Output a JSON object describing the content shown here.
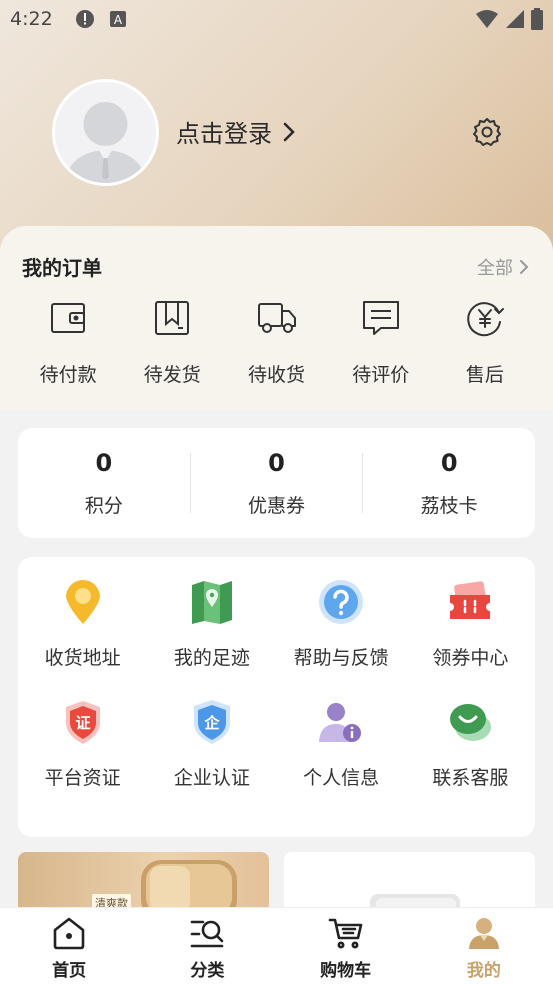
{
  "status_bar": {
    "time": "4:22",
    "icons": [
      "alert-icon",
      "keyboard-a-icon"
    ],
    "right_icons": [
      "wifi-icon",
      "signal-icon",
      "battery-icon"
    ]
  },
  "profile": {
    "login_label": "点击登录",
    "avatar_icon": "user-avatar-icon",
    "settings_icon": "gear-icon"
  },
  "orders": {
    "title": "我的订单",
    "all_label": "全部",
    "items": [
      {
        "label": "待付款",
        "icon": "wallet-icon"
      },
      {
        "label": "待发货",
        "icon": "package-icon"
      },
      {
        "label": "待收货",
        "icon": "truck-icon"
      },
      {
        "label": "待评价",
        "icon": "comment-icon"
      },
      {
        "label": "售后",
        "icon": "refund-icon"
      }
    ]
  },
  "stats": [
    {
      "value": "0",
      "label": "积分"
    },
    {
      "value": "0",
      "label": "优惠券"
    },
    {
      "value": "0",
      "label": "荔枝卡"
    }
  ],
  "services": [
    {
      "label": "收货地址",
      "icon": "location-pin-icon"
    },
    {
      "label": "我的足迹",
      "icon": "map-icon"
    },
    {
      "label": "帮助与反馈",
      "icon": "help-icon"
    },
    {
      "label": "领券中心",
      "icon": "coupon-icon"
    },
    {
      "label": "平台资证",
      "icon": "certificate-icon"
    },
    {
      "label": "企业认证",
      "icon": "enterprise-shield-icon"
    },
    {
      "label": "个人信息",
      "icon": "person-info-icon"
    },
    {
      "label": "联系客服",
      "icon": "customer-service-icon"
    }
  ],
  "products": {
    "left_tag": "清爽款"
  },
  "tabbar": {
    "items": [
      {
        "label": "首页",
        "icon": "home-icon",
        "active": false
      },
      {
        "label": "分类",
        "icon": "category-search-icon",
        "active": false
      },
      {
        "label": "购物车",
        "icon": "cart-icon",
        "active": false
      },
      {
        "label": "我的",
        "icon": "profile-icon",
        "active": true
      }
    ]
  },
  "colors": {
    "accent": "#c9a26b",
    "header_gradient_start": "#efe7dd",
    "header_gradient_end": "#d9bb98"
  }
}
